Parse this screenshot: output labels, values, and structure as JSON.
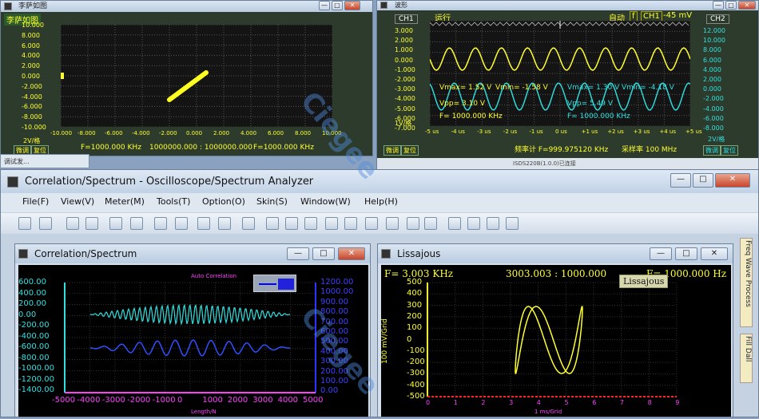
{
  "xy_window": {
    "title": "李萨如图",
    "panel_label": "李萨如图",
    "y_ticks": [
      "10.000",
      "8.000",
      "6.000",
      "4.000",
      "2.000",
      "0.000",
      "-2.000",
      "-4.000",
      "-6.000",
      "-8.000",
      "-10.000"
    ],
    "x_ticks": [
      "-10.000",
      "-8.000",
      "-6.000",
      "-4.000",
      "-2.000",
      "0.000",
      "2.000",
      "4.000",
      "6.000",
      "8.000",
      "10.000"
    ],
    "scale": "2V/格",
    "btn_fine": "微调",
    "btn_reset": "复位",
    "freq_left": "F=1000.000 KHz",
    "ratio": "1000000.000 : 1000000.000",
    "freq_right": "F=1000.000 KHz"
  },
  "scope_window": {
    "title": "波形",
    "ch1": "CH1",
    "ch2": "CH2",
    "run": "运行",
    "auto": "自动",
    "trig_sym": "f",
    "trig_ch": "CH1",
    "trig_level": "-45 mV",
    "y_ticks_left": [
      "3.000",
      "2.000",
      "1.000",
      "0.000",
      "-1.000",
      "-2.000",
      "-3.000",
      "-4.000",
      "-5.000",
      "-6.000",
      "-7.000"
    ],
    "y_ticks_right": [
      "12.000",
      "10.000",
      "8.000",
      "6.000",
      "4.000",
      "2.000",
      "0.000",
      "-2.000",
      "-4.000",
      "-6.000",
      "-8.000"
    ],
    "x_ticks": [
      "-5 us",
      "-4 us",
      "-3 us",
      "-2 us",
      "-1 us",
      "0 us",
      "+1 us",
      "+2 us",
      "+3 us",
      "+4 us",
      "+5 us"
    ],
    "scale_left": "1V/格",
    "scale_right": "2V/格",
    "vmax1": "Vmax= 1.52 V",
    "vmin1": "Vmin= -1.58 V",
    "vpp1": "Vpp= 3.10 V",
    "f1": "F= 1000.000 KHz",
    "vmax2": "Vmax= 1.30 V",
    "vmin2": "Vmin= -4.18 V",
    "vpp2": "Vpp= 5.49 V",
    "f2": "F= 1000.000 KHz",
    "freq_meter": "频率计 F=999.975120 KHz",
    "sample_rate": "采样率 100 MHz",
    "btn_fine": "微调",
    "btn_reset": "复位",
    "statusbar": "ISDS220B(1.0.0)已连接"
  },
  "small_tab": "调试发...",
  "main_window": {
    "title": "Correlation/Spectrum - Oscilloscope/Spectrum Analyzer",
    "menu": [
      "File(F)",
      "View(V)",
      "Meter(M)",
      "Tools(T)",
      "Option(O)",
      "Skin(S)",
      "Window(W)",
      "Help(H)"
    ]
  },
  "corr_window": {
    "title": "Correlation/Spectrum",
    "chart_title": "Auto Correlation",
    "x_label": "Length/N",
    "y_left": [
      "600.00",
      "400.00",
      "200.00",
      "0.00",
      "-200.00",
      "-400.00",
      "-600.00",
      "-800.00",
      "-1000.00",
      "-1200.00",
      "-1400.00"
    ],
    "y_right": [
      "1200.00",
      "1000.00",
      "900.00",
      "800.00",
      "700.00",
      "600.00",
      "500.00",
      "400.00",
      "300.00",
      "200.00",
      "100.00",
      "0.00"
    ],
    "x_ticks": [
      "-5000",
      "-4000",
      "-3000",
      "-2000",
      "-1000",
      "0",
      "1000",
      "2000",
      "3000",
      "4000",
      "5000"
    ]
  },
  "lissajous_window": {
    "title": "Lissajous",
    "f_left": "F= 3.003 KHz",
    "ratio": "3003.003 : 1000.000",
    "f_right": "F= 1000.000 Hz",
    "badge": "Lissajous",
    "y_label": "100 mV/Grid",
    "x_label": "1 ms/Grid",
    "y_ticks": [
      "500",
      "400",
      "300",
      "200",
      "100",
      "0",
      "-100",
      "-200",
      "-300",
      "-400",
      "-500"
    ],
    "x_ticks": [
      "0",
      "1",
      "2",
      "3",
      "4",
      "5",
      "6",
      "7",
      "8",
      "9"
    ]
  },
  "side_tabs": [
    "Freq Wave Process",
    "Fill Dall"
  ],
  "watermark": "Ciegee"
}
